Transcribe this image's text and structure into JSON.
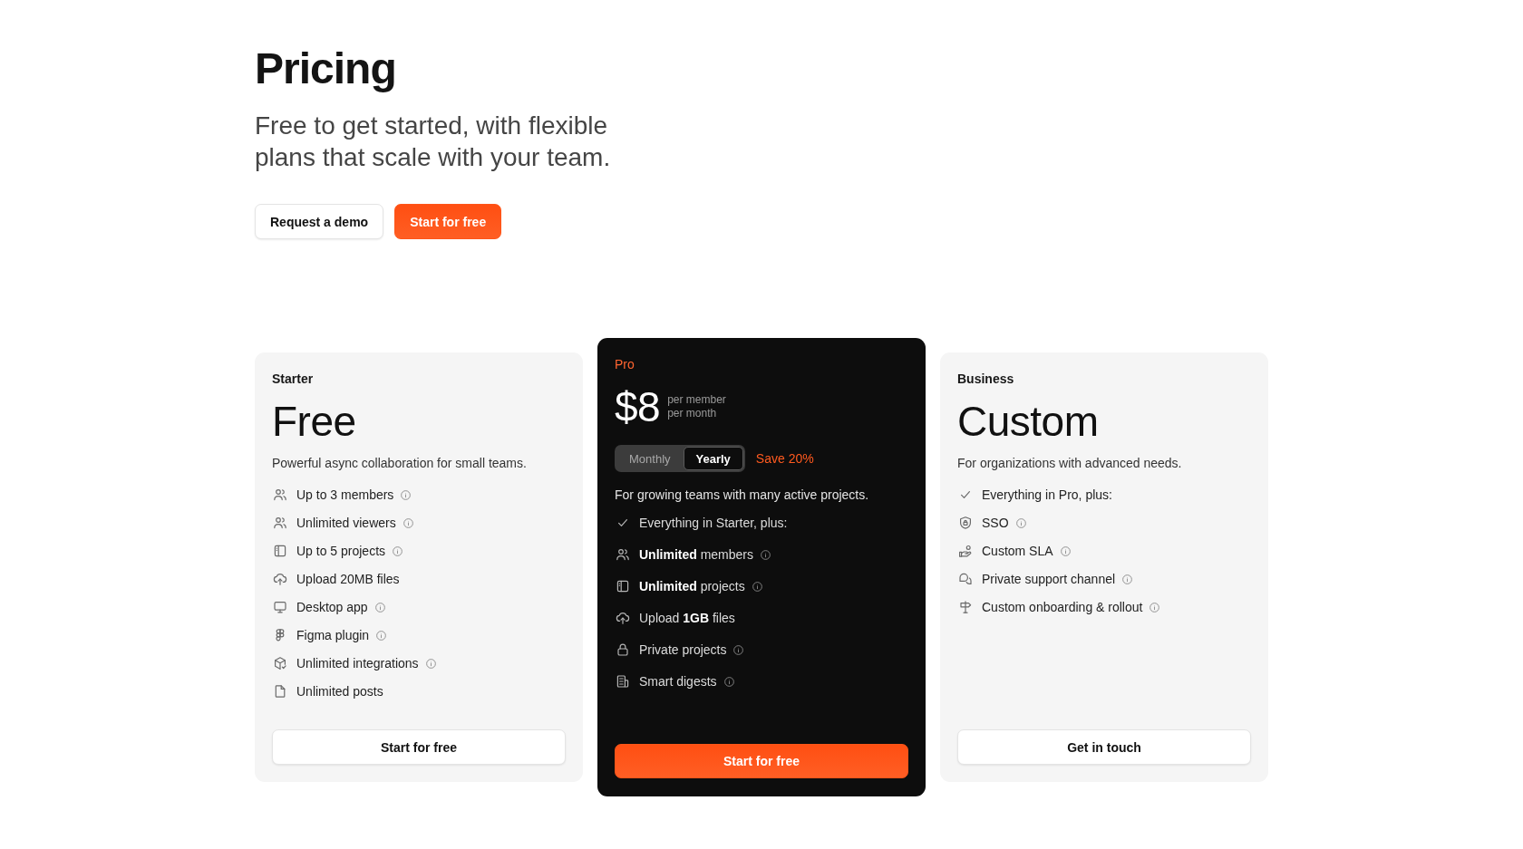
{
  "header": {
    "title": "Pricing",
    "subtitle": "Free to get started, with flexible plans that scale with your team.",
    "buttons": [
      {
        "label": "Request a demo",
        "kind": "secondary"
      },
      {
        "label": "Start for free",
        "kind": "primary"
      }
    ]
  },
  "plans": [
    {
      "name": "Starter",
      "featured": false,
      "price": "Free",
      "description": "Powerful async collaboration for small teams.",
      "features": [
        {
          "text": "Up to 3 members",
          "info": true
        },
        {
          "text": "Unlimited viewers",
          "info": true
        },
        {
          "text": "Up to 5 projects",
          "info": true
        },
        {
          "text": "Upload 20MB files",
          "info": false
        },
        {
          "text": "Desktop app",
          "info": true
        },
        {
          "text": "Figma plugin",
          "info": true
        },
        {
          "text": "Unlimited integrations",
          "info": true
        },
        {
          "text": "Unlimited posts",
          "info": false
        }
      ],
      "button": {
        "label": "Start for free",
        "kind": "secondary"
      }
    },
    {
      "name": "Pro",
      "featured": true,
      "price": "$8",
      "price_unit": [
        "per member",
        "per month"
      ],
      "billing_toggle": [
        {
          "label": "Monthly",
          "selected": false
        },
        {
          "label": "Yearly",
          "selected": true
        }
      ],
      "savings": "Save 20%",
      "description": "For growing teams with many active projects.",
      "features": [
        {
          "text": "Everything in Starter, plus:",
          "info": false
        },
        {
          "text": "**Unlimited** members",
          "info": true
        },
        {
          "text": "**Unlimited** projects",
          "info": true
        },
        {
          "text": "Upload **1GB** files",
          "info": false
        },
        {
          "text": "Private projects",
          "info": true
        },
        {
          "text": "Smart digests",
          "info": true
        }
      ],
      "button": {
        "label": "Start for free",
        "kind": "primary"
      }
    },
    {
      "name": "Business",
      "featured": false,
      "price": "Custom",
      "description": "For organizations with advanced needs.",
      "features": [
        {
          "text": "Everything in Pro, plus:",
          "info": false
        },
        {
          "text": "SSO",
          "info": true
        },
        {
          "text": "Custom SLA",
          "info": true
        },
        {
          "text": "Private support channel",
          "info": true
        },
        {
          "text": "Custom onboarding & rollout",
          "info": true
        }
      ],
      "button": {
        "label": "Get in touch",
        "kind": "secondary"
      }
    }
  ]
}
